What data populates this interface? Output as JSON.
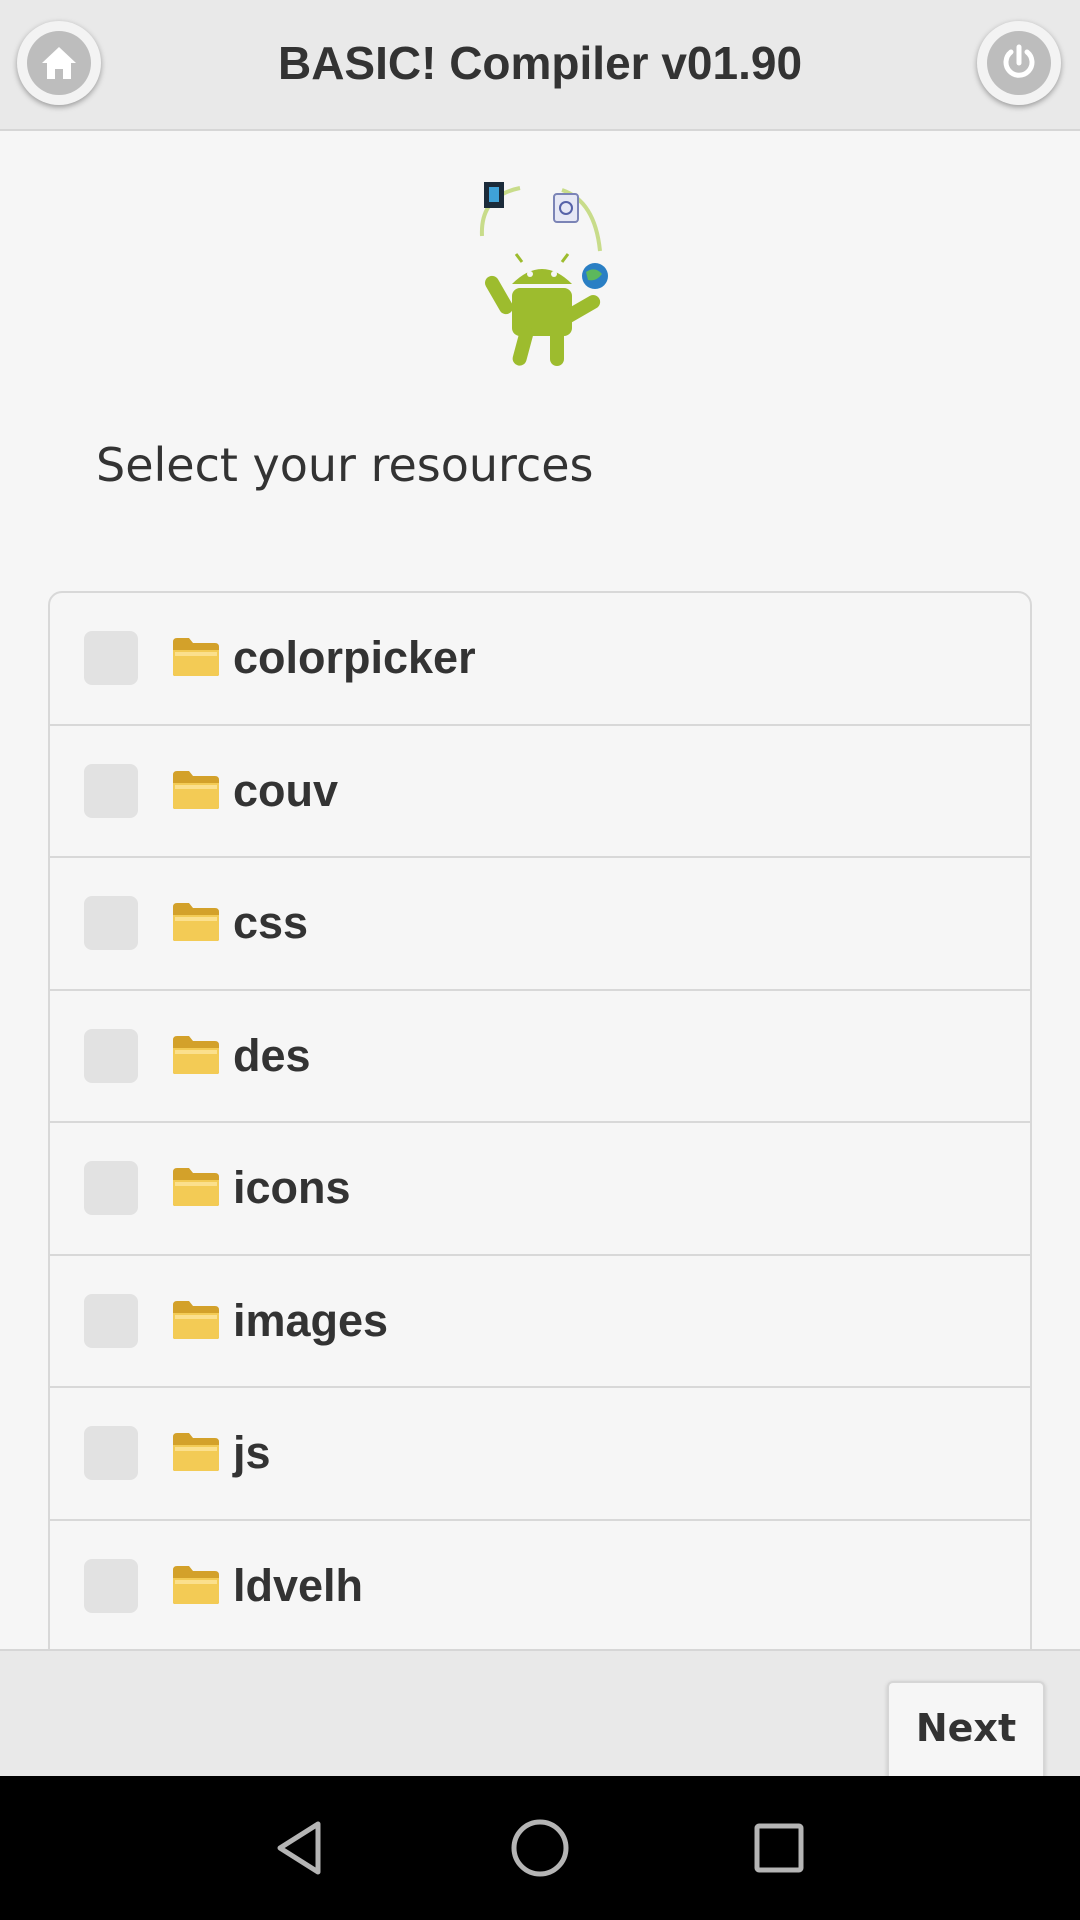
{
  "header": {
    "title": "BASIC! Compiler v01.90",
    "home_icon": "home-icon",
    "power_icon": "power-icon"
  },
  "main": {
    "subtitle": "Select your resources",
    "items": [
      {
        "label": "colorpicker",
        "checked": false
      },
      {
        "label": "couv",
        "checked": false
      },
      {
        "label": "css",
        "checked": false
      },
      {
        "label": "des",
        "checked": false
      },
      {
        "label": "icons",
        "checked": false
      },
      {
        "label": "images",
        "checked": false
      },
      {
        "label": "js",
        "checked": false
      },
      {
        "label": "ldvelh",
        "checked": false
      }
    ]
  },
  "footer": {
    "next_label": "Next"
  },
  "navbar": {
    "back_icon": "back-icon",
    "home_icon": "home-circle-icon",
    "recents_icon": "recents-icon"
  },
  "colors": {
    "header_bg": "#e9e9e9",
    "body_bg": "#f6f6f6",
    "text": "#333333",
    "android_green": "#9dbc2e"
  }
}
